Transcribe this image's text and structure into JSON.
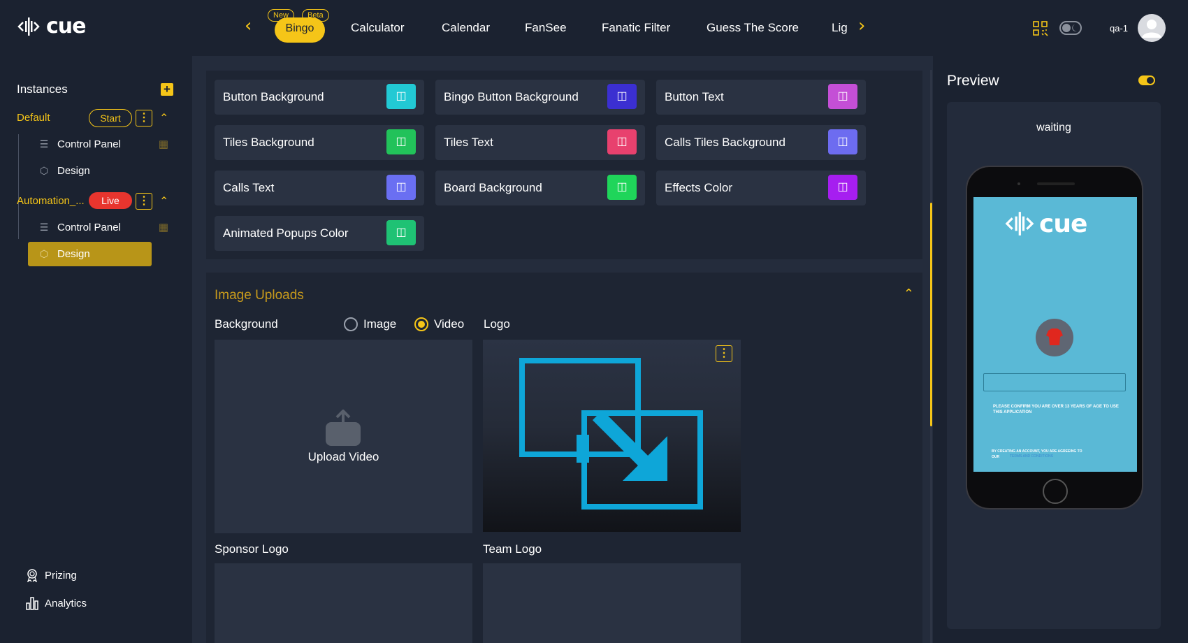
{
  "app": {
    "logo_text": "cue"
  },
  "topnav": {
    "tabs": [
      {
        "label": "Bingo",
        "badges": [
          "New",
          "Beta"
        ],
        "active": true
      },
      {
        "label": "Calculator"
      },
      {
        "label": "Calendar"
      },
      {
        "label": "FanSee"
      },
      {
        "label": "Fanatic Filter"
      },
      {
        "label": "Guess The Score"
      },
      {
        "label": "Lig"
      }
    ],
    "user": "qa-1"
  },
  "sidebar": {
    "title": "Instances",
    "instances": [
      {
        "name": "Default",
        "status": "Start",
        "items": [
          {
            "label": "Control Panel"
          },
          {
            "label": "Design"
          }
        ]
      },
      {
        "name": "Automation_...",
        "status": "Live",
        "items": [
          {
            "label": "Control Panel"
          },
          {
            "label": "Design",
            "active": true
          }
        ]
      }
    ],
    "bottom": [
      {
        "label": "Prizing"
      },
      {
        "label": "Analytics"
      }
    ]
  },
  "colors": [
    {
      "label": "Button Background",
      "color": "#22c9d4"
    },
    {
      "label": "Bingo Button Background",
      "color": "#3b2fd1"
    },
    {
      "label": "Button Text",
      "color": "#c44fd6"
    },
    {
      "label": "Tiles Background",
      "color": "#22c25a"
    },
    {
      "label": "Tiles Text",
      "color": "#e8416e"
    },
    {
      "label": "Calls Tiles Background",
      "color": "#6d6cf0"
    },
    {
      "label": "Calls Text",
      "color": "#6a6ff2"
    },
    {
      "label": "Board Background",
      "color": "#1fd55a"
    },
    {
      "label": "Effects Color",
      "color": "#a61ef0"
    },
    {
      "label": "Animated Popups Color",
      "color": "#1fc274"
    }
  ],
  "image_uploads": {
    "title": "Image Uploads",
    "background_label": "Background",
    "radio_image": "Image",
    "radio_video": "Video",
    "selected": "Video",
    "upload_video": "Upload Video",
    "logo_label": "Logo",
    "sponsor_logo_label": "Sponsor Logo",
    "team_logo_label": "Team Logo"
  },
  "preview": {
    "title": "Preview",
    "status": "waiting",
    "screen_logo": "cue",
    "confirm_text": "PLEASE CONFIRM YOU ARE OVER 13 YEARS OF AGE TO USE THIS APPLICATION",
    "terms_text": "BY CREATING AN ACCOUNT, YOU ARE AGREEING TO OUR",
    "terms_link": "TERMS AND CONDITIONS"
  }
}
